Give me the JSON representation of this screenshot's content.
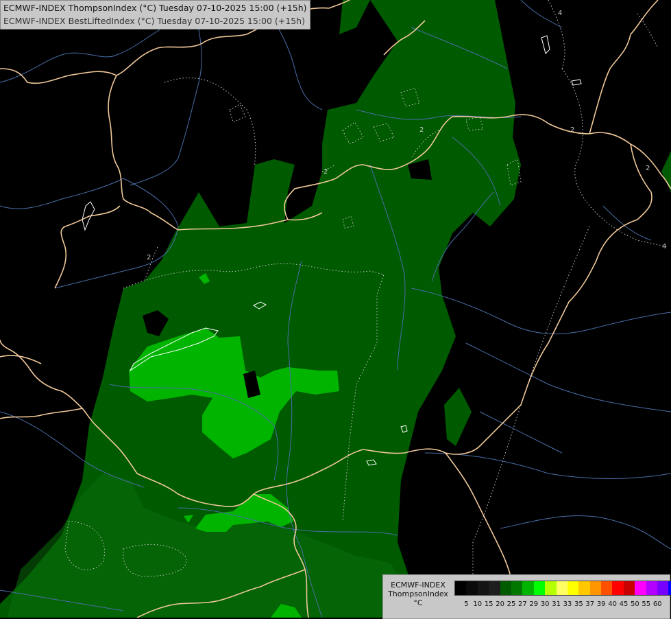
{
  "title": {
    "line1": "ECMWF-INDEX ThompsonIndex (°C) Tuesday 07-10-2025 15:00 (+15h)",
    "line2": "ECMWF-INDEX BestLiftedIndex (°C) Tuesday 07-10-2025 15:00 (+15h)"
  },
  "legend": {
    "title_line1": "ECMWF-INDEX",
    "title_line2": "ThompsonIndex",
    "unit": "°C",
    "ticks": [
      "5",
      "10",
      "15",
      "20",
      "25",
      "27",
      "29",
      "30",
      "31",
      "33",
      "35",
      "37",
      "39",
      "40",
      "45",
      "50",
      "55",
      "60"
    ],
    "colors": [
      "#000000",
      "#0a0a0a",
      "#141414",
      "#1e1e1e",
      "#005a00",
      "#007800",
      "#00b400",
      "#00ff00",
      "#b4ff00",
      "#ffff64",
      "#ffff00",
      "#ffc800",
      "#ff9600",
      "#ff5000",
      "#ff0000",
      "#c80000",
      "#ff00ff",
      "#b400ff",
      "#7800ff",
      "#0000ff"
    ]
  },
  "map": {
    "contour_labels": [
      "2",
      "2",
      "2",
      "2",
      "2",
      "4",
      "4"
    ],
    "colors": {
      "background": "#000000",
      "fill_dark": "#005a00",
      "fill_mid": "#007800",
      "fill_light": "#00b400",
      "border": "#f0c89a",
      "river": "#4a6ea8",
      "contour": "#c8c8c8"
    }
  }
}
